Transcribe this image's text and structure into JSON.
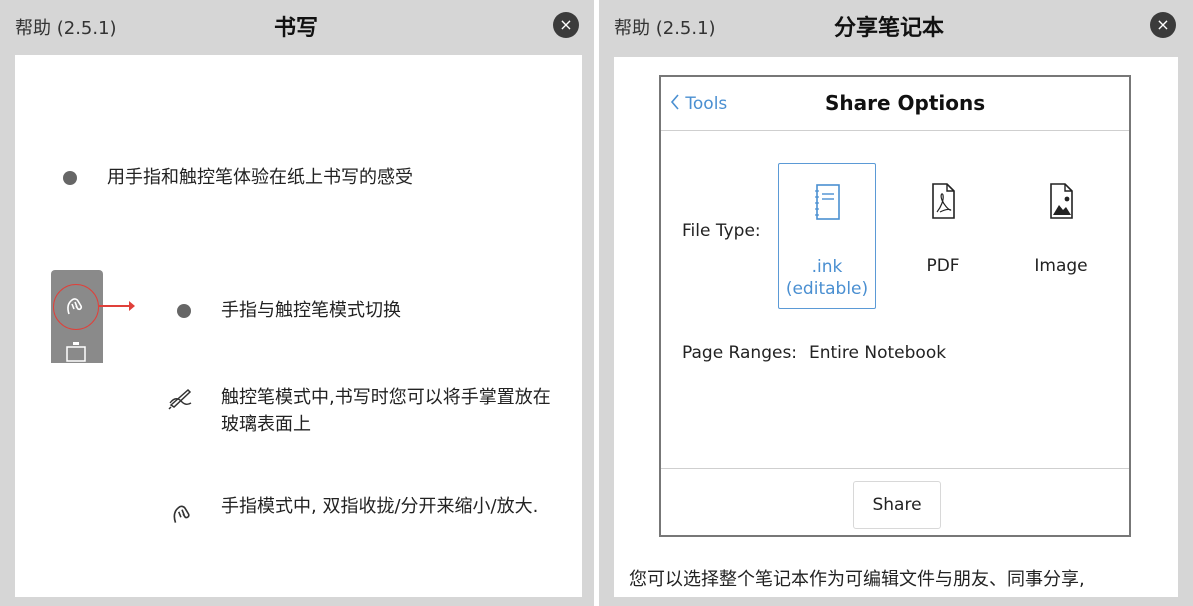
{
  "left": {
    "version": "帮助 (2.5.1)",
    "title": "书写",
    "close_icon": "×",
    "bullet1": "用手指和触控笔体验在纸上书写的感受",
    "bullet2": "手指与触控笔模式切换",
    "stylus_mode_text": "触控笔模式中,书写时您可以将手掌置放在玻璃表面上",
    "finger_mode_text": "手指模式中, 双指收拢/分开来缩小/放大."
  },
  "right": {
    "version": "帮助 (2.5.1)",
    "title": "分享笔记本",
    "close_icon": "×",
    "dialog": {
      "back_label": "Tools",
      "title": "Share Options",
      "file_type_label": "File Type:",
      "options": [
        {
          "label": ".ink (editable)",
          "icon": "notebook-icon",
          "selected": true
        },
        {
          "label": "PDF",
          "icon": "pdf-icon",
          "selected": false
        },
        {
          "label": "Image",
          "icon": "image-icon",
          "selected": false
        }
      ],
      "page_ranges_label": "Page Ranges:",
      "page_ranges_value": "Entire Notebook",
      "share_button": "Share"
    },
    "caption": "您可以选择整个笔记本作为可编辑文件与朋友、同事分享,"
  },
  "colors": {
    "accent": "#4a8fd1",
    "close_bg": "#3b3b3b",
    "toolbar_gray": "#8a8a8a",
    "toolbar_red": "#e0403a"
  }
}
